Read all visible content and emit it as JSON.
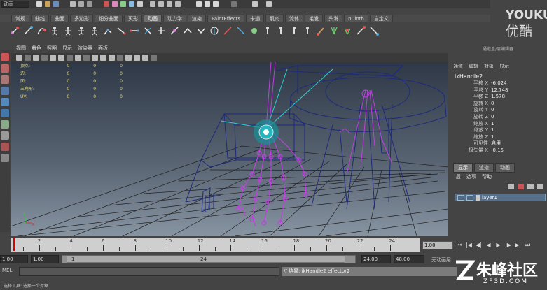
{
  "status_line": {
    "menu_set": "动画"
  },
  "shelf_tabs": [
    "常规",
    "曲线",
    "曲面",
    "多边形",
    "细分曲面",
    "灭形",
    "动画",
    "动力学",
    "渲染",
    "PaintEffects",
    "卡通",
    "肌肉",
    "流体",
    "毛发",
    "头发",
    "nCloth",
    "自定义"
  ],
  "shelf_active": "动画",
  "panel_menu": [
    "视图",
    "着色",
    "照明",
    "显示",
    "渲染器",
    "面板"
  ],
  "hud": {
    "rows": [
      {
        "label": "顶点:",
        "values": [
          "0",
          "0",
          "0"
        ]
      },
      {
        "label": "边:",
        "values": [
          "0",
          "0",
          "0"
        ]
      },
      {
        "label": "面:",
        "values": [
          "0",
          "0",
          "0"
        ]
      },
      {
        "label": "三角形:",
        "values": [
          "0",
          "0",
          "0"
        ]
      },
      {
        "label": "UV:",
        "values": [
          "0",
          "0",
          "0"
        ]
      }
    ]
  },
  "channel_box": {
    "title": "通道盒/层编辑器",
    "menu": [
      "通道",
      "编辑",
      "对象",
      "显示"
    ],
    "object": "ikHandle2",
    "channels": [
      {
        "label": "平移 X",
        "value": "-6.024"
      },
      {
        "label": "平移 Y",
        "value": "12.748"
      },
      {
        "label": "平移 Z",
        "value": "1.578"
      },
      {
        "label": "旋转 X",
        "value": "0"
      },
      {
        "label": "旋转 Y",
        "value": "0"
      },
      {
        "label": "旋转 Z",
        "value": "0"
      },
      {
        "label": "缩放 X",
        "value": "1"
      },
      {
        "label": "缩放 Y",
        "value": "1"
      },
      {
        "label": "缩放 Z",
        "value": "1"
      },
      {
        "label": "可见性",
        "value": "启用"
      },
      {
        "label": "极矢量 X",
        "value": "-0.15"
      }
    ]
  },
  "layer_tabs": [
    "显示",
    "渲染",
    "动画"
  ],
  "layer_tab_active": "显示",
  "layer_menu": [
    "层",
    "选项",
    "帮助"
  ],
  "layer_name": "layer1",
  "time_slider": {
    "ticks": [
      "2",
      "4",
      "6",
      "8",
      "10",
      "12",
      "14",
      "16",
      "18",
      "20",
      "22",
      "24"
    ],
    "current_frame": "1.00"
  },
  "range": {
    "start": "1.00",
    "anim_start": "1.00",
    "handle_start": "1",
    "handle_end": "24",
    "end": "24.00",
    "anim_end": "48.00",
    "auto_key": "无动画层"
  },
  "command_line": {
    "label": "MEL",
    "result": "// 结果: ikHandle2 effector2"
  },
  "help_line": "选择工具: 选择一个对象",
  "watermark": {
    "youku1": "YOUKU",
    "youku2": "优酷",
    "zf3d": "朱峰社区",
    "zf3d_sub": "ZF3D.COM"
  },
  "colors": {
    "viewport_top": "#2e3846",
    "viewport_bottom": "#8794a2",
    "layer_row": "#56708c",
    "accent_purple": "#c040e0",
    "accent_cyan": "#30d0d0"
  }
}
